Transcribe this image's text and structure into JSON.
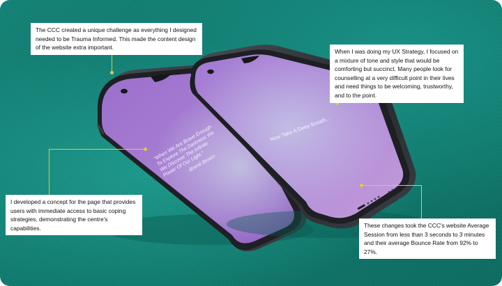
{
  "callouts": {
    "trauma_informed": "The CCC created a unique challenge as everything I designed needed to be Trauma Informed. This made the content design of the website extra important.",
    "ux_strategy": "When I was doing my UX Strategy, I focused on a mixture of tone and style that would be comforting but succinct. Many people look for counselling at a very difficult point in their lives and need things to be welcoming, trustworthy, and to the point.",
    "coping_concept": "I developed a concept for the page that provides users with immediate access to basic coping strategies, demonstrating the centre's capabilities.",
    "results": "These changes took the CCC's website Average Session from less than 3 seconds to 3 minutes and their average Bounce Rate from 92% to 27%."
  },
  "phone_back": {
    "quote_lines": [
      "\"When We Are Brave Enough",
      "To Explore The Darkness We",
      "We Discover The Infinite",
      "Power Of Our Light.\""
    ],
    "author": "-Brené Brown"
  },
  "phone_front": {
    "screen_text": "Now Take A Deep Breath..."
  },
  "colors": {
    "background": "#12806f",
    "accent_leader": "#e2c84a",
    "screen_purple": "#a173d0",
    "phone_frame": "#2a2d31"
  }
}
